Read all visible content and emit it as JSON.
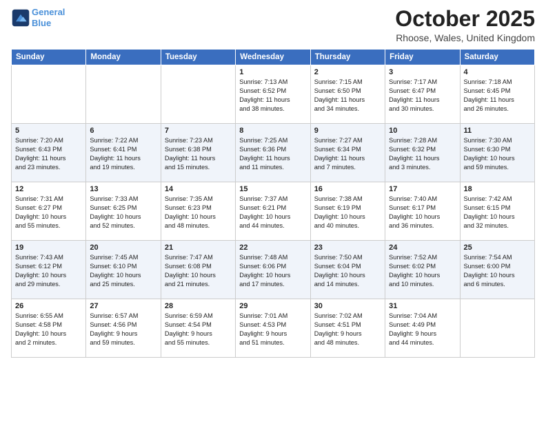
{
  "header": {
    "logo_line1": "General",
    "logo_line2": "Blue",
    "month": "October 2025",
    "location": "Rhoose, Wales, United Kingdom"
  },
  "weekdays": [
    "Sunday",
    "Monday",
    "Tuesday",
    "Wednesday",
    "Thursday",
    "Friday",
    "Saturday"
  ],
  "weeks": [
    [
      {
        "day": "",
        "info": ""
      },
      {
        "day": "",
        "info": ""
      },
      {
        "day": "",
        "info": ""
      },
      {
        "day": "1",
        "info": "Sunrise: 7:13 AM\nSunset: 6:52 PM\nDaylight: 11 hours\nand 38 minutes."
      },
      {
        "day": "2",
        "info": "Sunrise: 7:15 AM\nSunset: 6:50 PM\nDaylight: 11 hours\nand 34 minutes."
      },
      {
        "day": "3",
        "info": "Sunrise: 7:17 AM\nSunset: 6:47 PM\nDaylight: 11 hours\nand 30 minutes."
      },
      {
        "day": "4",
        "info": "Sunrise: 7:18 AM\nSunset: 6:45 PM\nDaylight: 11 hours\nand 26 minutes."
      }
    ],
    [
      {
        "day": "5",
        "info": "Sunrise: 7:20 AM\nSunset: 6:43 PM\nDaylight: 11 hours\nand 23 minutes."
      },
      {
        "day": "6",
        "info": "Sunrise: 7:22 AM\nSunset: 6:41 PM\nDaylight: 11 hours\nand 19 minutes."
      },
      {
        "day": "7",
        "info": "Sunrise: 7:23 AM\nSunset: 6:38 PM\nDaylight: 11 hours\nand 15 minutes."
      },
      {
        "day": "8",
        "info": "Sunrise: 7:25 AM\nSunset: 6:36 PM\nDaylight: 11 hours\nand 11 minutes."
      },
      {
        "day": "9",
        "info": "Sunrise: 7:27 AM\nSunset: 6:34 PM\nDaylight: 11 hours\nand 7 minutes."
      },
      {
        "day": "10",
        "info": "Sunrise: 7:28 AM\nSunset: 6:32 PM\nDaylight: 11 hours\nand 3 minutes."
      },
      {
        "day": "11",
        "info": "Sunrise: 7:30 AM\nSunset: 6:30 PM\nDaylight: 10 hours\nand 59 minutes."
      }
    ],
    [
      {
        "day": "12",
        "info": "Sunrise: 7:31 AM\nSunset: 6:27 PM\nDaylight: 10 hours\nand 55 minutes."
      },
      {
        "day": "13",
        "info": "Sunrise: 7:33 AM\nSunset: 6:25 PM\nDaylight: 10 hours\nand 52 minutes."
      },
      {
        "day": "14",
        "info": "Sunrise: 7:35 AM\nSunset: 6:23 PM\nDaylight: 10 hours\nand 48 minutes."
      },
      {
        "day": "15",
        "info": "Sunrise: 7:37 AM\nSunset: 6:21 PM\nDaylight: 10 hours\nand 44 minutes."
      },
      {
        "day": "16",
        "info": "Sunrise: 7:38 AM\nSunset: 6:19 PM\nDaylight: 10 hours\nand 40 minutes."
      },
      {
        "day": "17",
        "info": "Sunrise: 7:40 AM\nSunset: 6:17 PM\nDaylight: 10 hours\nand 36 minutes."
      },
      {
        "day": "18",
        "info": "Sunrise: 7:42 AM\nSunset: 6:15 PM\nDaylight: 10 hours\nand 32 minutes."
      }
    ],
    [
      {
        "day": "19",
        "info": "Sunrise: 7:43 AM\nSunset: 6:12 PM\nDaylight: 10 hours\nand 29 minutes."
      },
      {
        "day": "20",
        "info": "Sunrise: 7:45 AM\nSunset: 6:10 PM\nDaylight: 10 hours\nand 25 minutes."
      },
      {
        "day": "21",
        "info": "Sunrise: 7:47 AM\nSunset: 6:08 PM\nDaylight: 10 hours\nand 21 minutes."
      },
      {
        "day": "22",
        "info": "Sunrise: 7:48 AM\nSunset: 6:06 PM\nDaylight: 10 hours\nand 17 minutes."
      },
      {
        "day": "23",
        "info": "Sunrise: 7:50 AM\nSunset: 6:04 PM\nDaylight: 10 hours\nand 14 minutes."
      },
      {
        "day": "24",
        "info": "Sunrise: 7:52 AM\nSunset: 6:02 PM\nDaylight: 10 hours\nand 10 minutes."
      },
      {
        "day": "25",
        "info": "Sunrise: 7:54 AM\nSunset: 6:00 PM\nDaylight: 10 hours\nand 6 minutes."
      }
    ],
    [
      {
        "day": "26",
        "info": "Sunrise: 6:55 AM\nSunset: 4:58 PM\nDaylight: 10 hours\nand 2 minutes."
      },
      {
        "day": "27",
        "info": "Sunrise: 6:57 AM\nSunset: 4:56 PM\nDaylight: 9 hours\nand 59 minutes."
      },
      {
        "day": "28",
        "info": "Sunrise: 6:59 AM\nSunset: 4:54 PM\nDaylight: 9 hours\nand 55 minutes."
      },
      {
        "day": "29",
        "info": "Sunrise: 7:01 AM\nSunset: 4:53 PM\nDaylight: 9 hours\nand 51 minutes."
      },
      {
        "day": "30",
        "info": "Sunrise: 7:02 AM\nSunset: 4:51 PM\nDaylight: 9 hours\nand 48 minutes."
      },
      {
        "day": "31",
        "info": "Sunrise: 7:04 AM\nSunset: 4:49 PM\nDaylight: 9 hours\nand 44 minutes."
      },
      {
        "day": "",
        "info": ""
      }
    ]
  ]
}
